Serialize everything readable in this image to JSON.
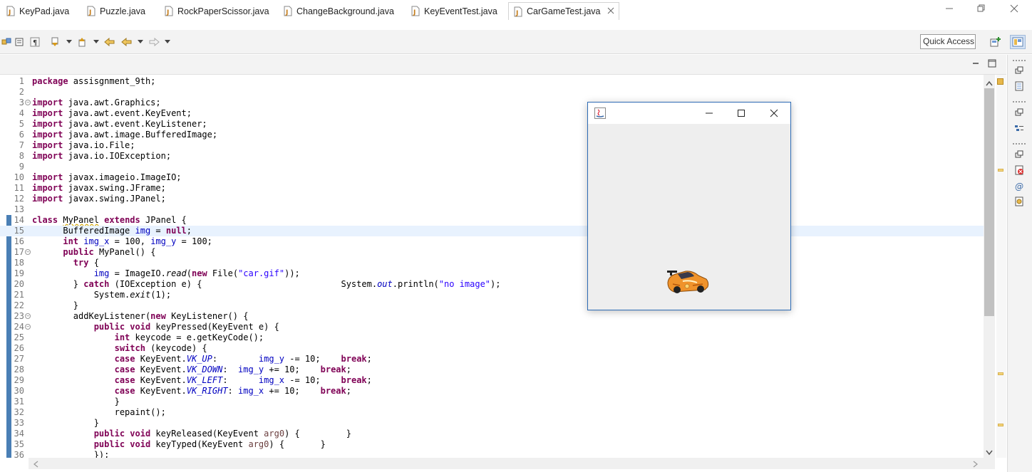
{
  "window": {
    "controls": [
      "minimize-icon",
      "restore-icon",
      "close-icon"
    ]
  },
  "toolbar": {
    "quick_access_label": "Quick Access"
  },
  "tabs": [
    {
      "label": "KeyPad.java",
      "active": false
    },
    {
      "label": "Puzzle.java",
      "active": false
    },
    {
      "label": "RockPaperScissor.java",
      "active": false
    },
    {
      "label": "ChangeBackground.java",
      "active": false
    },
    {
      "label": "KeyEventTest.java",
      "active": false
    },
    {
      "label": "CarGameTest.java",
      "active": true
    }
  ],
  "editor": {
    "line_numbers": [
      "1",
      "2",
      "3",
      "4",
      "5",
      "6",
      "7",
      "8",
      "9",
      "10",
      "11",
      "12",
      "13",
      "14",
      "15",
      "16",
      "17",
      "18",
      "19",
      "20",
      "21",
      "22",
      "23",
      "24",
      "25",
      "26",
      "27",
      "28",
      "29",
      "30",
      "31",
      "32",
      "33",
      "34",
      "35",
      "36"
    ],
    "current_line": 15
  },
  "colors": {
    "keyword": "#7f0055",
    "string": "#2a00ff",
    "field": "#0000c0",
    "current_line_bg": "#e8f2fe",
    "frame_border": "#2d6bb5"
  },
  "java_frame": {
    "title": "",
    "content": "car-image"
  }
}
